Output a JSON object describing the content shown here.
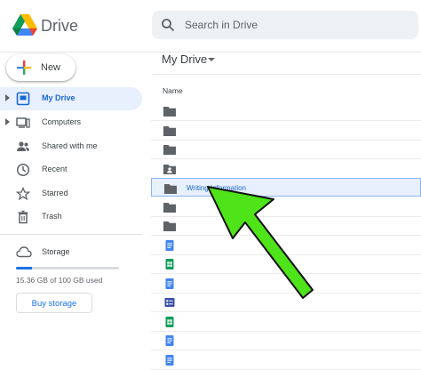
{
  "app": {
    "name": "Drive"
  },
  "search": {
    "placeholder": "Search in Drive"
  },
  "new_button": {
    "label": "New"
  },
  "sidebar": {
    "items": [
      {
        "label": "My Drive",
        "icon": "my-drive-icon",
        "active": true,
        "expandable": true
      },
      {
        "label": "Computers",
        "icon": "computers-icon",
        "active": false,
        "expandable": true
      },
      {
        "label": "Shared with me",
        "icon": "shared-icon",
        "active": false,
        "expandable": false
      },
      {
        "label": "Recent",
        "icon": "clock-icon",
        "active": false,
        "expandable": false
      },
      {
        "label": "Starred",
        "icon": "star-icon",
        "active": false,
        "expandable": false
      },
      {
        "label": "Trash",
        "icon": "trash-icon",
        "active": false,
        "expandable": false
      }
    ],
    "storage": {
      "label": "Storage",
      "usage_text": "15.36 GB of 100 GB used",
      "used_fraction": 0.1536,
      "buy_label": "Buy storage"
    }
  },
  "main": {
    "title": "My Drive",
    "column_name": "Name",
    "selected_file": {
      "name": "Writing Information",
      "type": "folder"
    },
    "files": [
      {
        "type": "folder"
      },
      {
        "type": "folder"
      },
      {
        "type": "folder"
      },
      {
        "type": "shared-folder"
      },
      {
        "type": "folder",
        "name": "Writing Information",
        "selected": true
      },
      {
        "type": "folder"
      },
      {
        "type": "folder"
      },
      {
        "type": "doc"
      },
      {
        "type": "sheet"
      },
      {
        "type": "doc"
      },
      {
        "type": "form"
      },
      {
        "type": "sheet"
      },
      {
        "type": "doc"
      },
      {
        "type": "doc"
      }
    ]
  },
  "colors": {
    "accent": "#1a73e8",
    "active_bg": "#e8f0fe",
    "folder": "#5f6368",
    "doc": "#4285f4",
    "sheet": "#0f9d58",
    "form": "#3b4fa8",
    "annotation_arrow": "#4fe31a"
  }
}
